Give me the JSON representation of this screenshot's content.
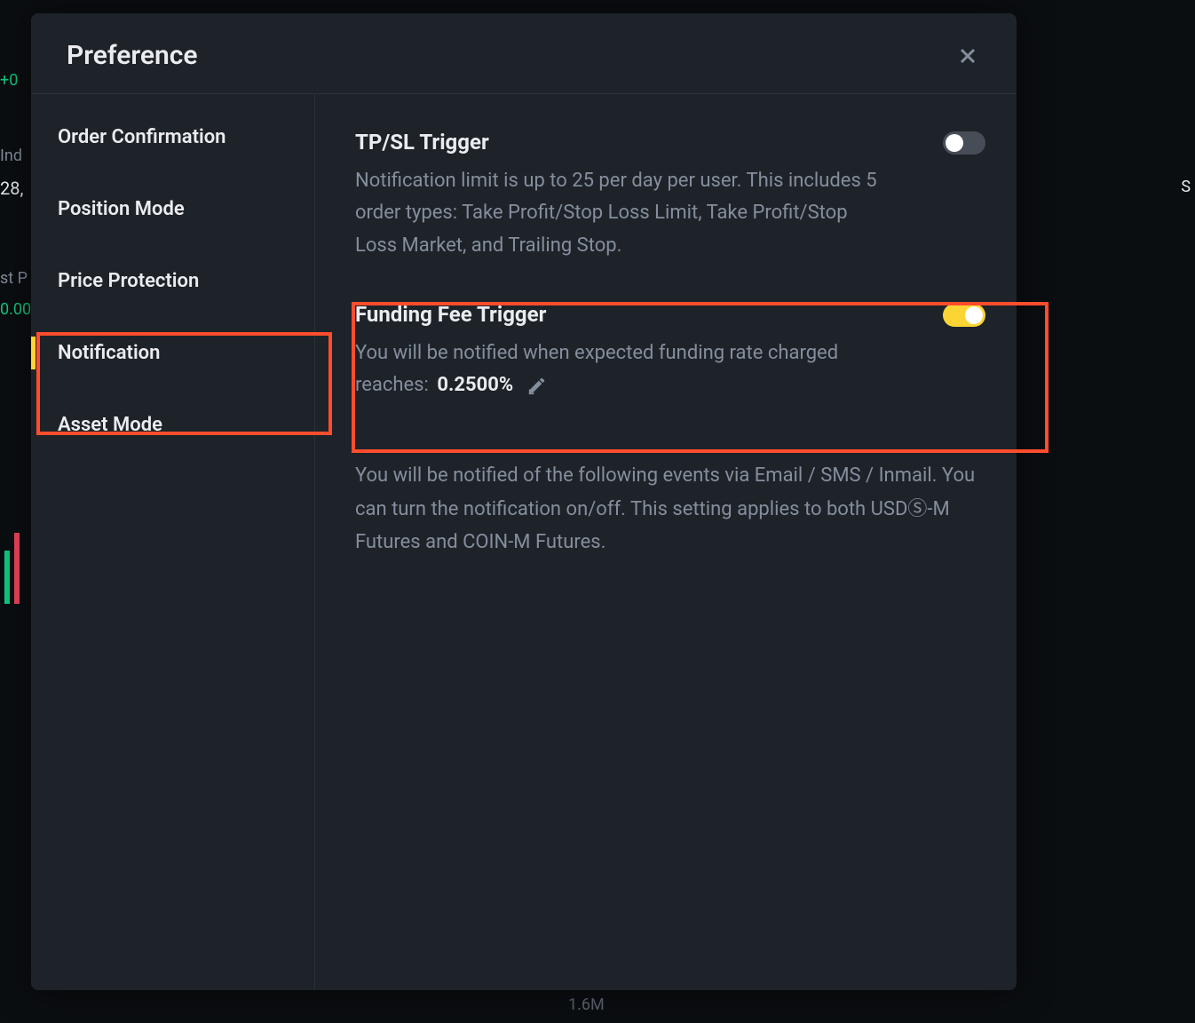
{
  "modal": {
    "title": "Preference"
  },
  "sidebar": {
    "items": [
      {
        "label": "Order Confirmation",
        "active": false
      },
      {
        "label": "Position Mode",
        "active": false
      },
      {
        "label": "Price Protection",
        "active": false
      },
      {
        "label": "Notification",
        "active": true
      },
      {
        "label": "Asset Mode",
        "active": false
      }
    ]
  },
  "content": {
    "tpsl": {
      "title": "TP/SL Trigger",
      "desc": "Notification limit is up to 25 per day per user. This includes 5 order types: Take Profit/Stop Loss Limit, Take Profit/Stop Loss Market, and Trailing Stop.",
      "enabled": false
    },
    "funding": {
      "title": "Funding Fee Trigger",
      "desc_prefix": "You will be notified when expected funding rate charged reaches:",
      "value": "0.2500%",
      "enabled": true
    },
    "info": "You will be notified of the following events via Email / SMS / Inmail. You can turn the notification on/off. This setting applies to both USDⓈ-M Futures and COIN-M Futures."
  },
  "background": {
    "ind_label": "Ind",
    "price_fragment": "28,",
    "st_p": "st P",
    "pct": "0.00",
    "s_label": "S",
    "plus": "+0",
    "vol": "1.6M"
  }
}
